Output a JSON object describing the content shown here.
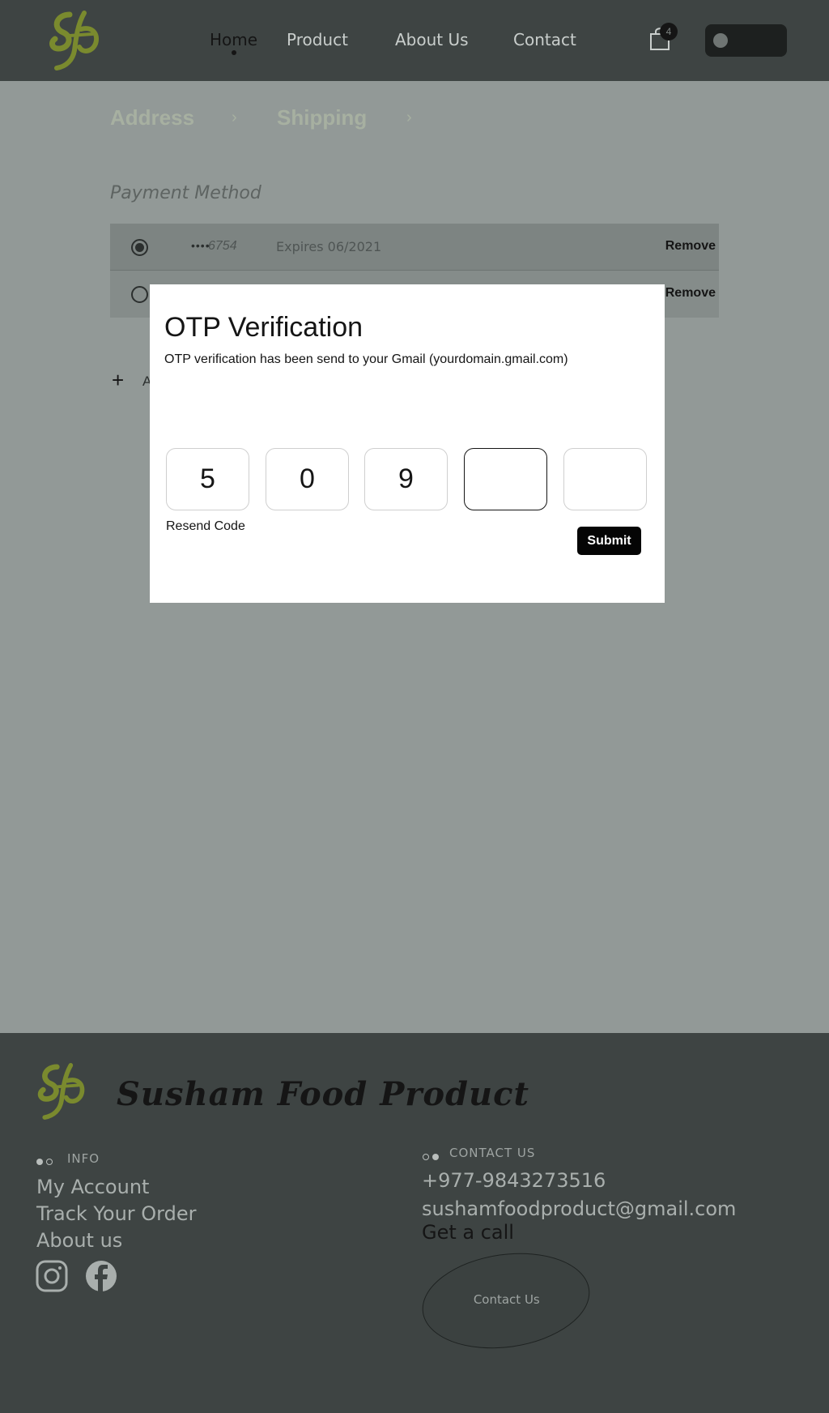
{
  "header": {
    "nav": [
      "Home",
      "Product",
      "About Us",
      "Contact"
    ],
    "active_nav": "Home",
    "cart_count": "4"
  },
  "checkout": {
    "steps": [
      "Address",
      "Shipping"
    ],
    "payment_title": "Payment Method",
    "cards": [
      {
        "dots": "••••",
        "number": "6754",
        "expires": "Expires 06/2021",
        "remove": "Remove",
        "selected": true
      },
      {
        "remove": "Remove",
        "selected": false
      }
    ],
    "add_label": "A"
  },
  "modal": {
    "title": "OTP Verification",
    "description": "OTP verification has been send to your Gmail (yourdomain.gmail.com)",
    "digits": [
      "5",
      "0",
      "9",
      "",
      ""
    ],
    "resend": "Resend Code",
    "submit": "Submit"
  },
  "footer": {
    "brand": "Susham Food Product",
    "info_title": "INFO",
    "info_links": [
      "My Account",
      "Track Your Order",
      "About us"
    ],
    "contact_title": "CONTACT US",
    "phone": "+977-9843273516",
    "email": "sushamfoodproduct@gmail.com",
    "get_call": "Get a call",
    "contact_button": "Contact Us"
  },
  "colors": {
    "accent_green": "#7a8a2e",
    "header_bg": "#3e4443",
    "overlay_page": "#929997"
  },
  "icons": [
    "logo-mark",
    "cart-icon",
    "plus-icon",
    "instagram-icon",
    "facebook-icon"
  ]
}
